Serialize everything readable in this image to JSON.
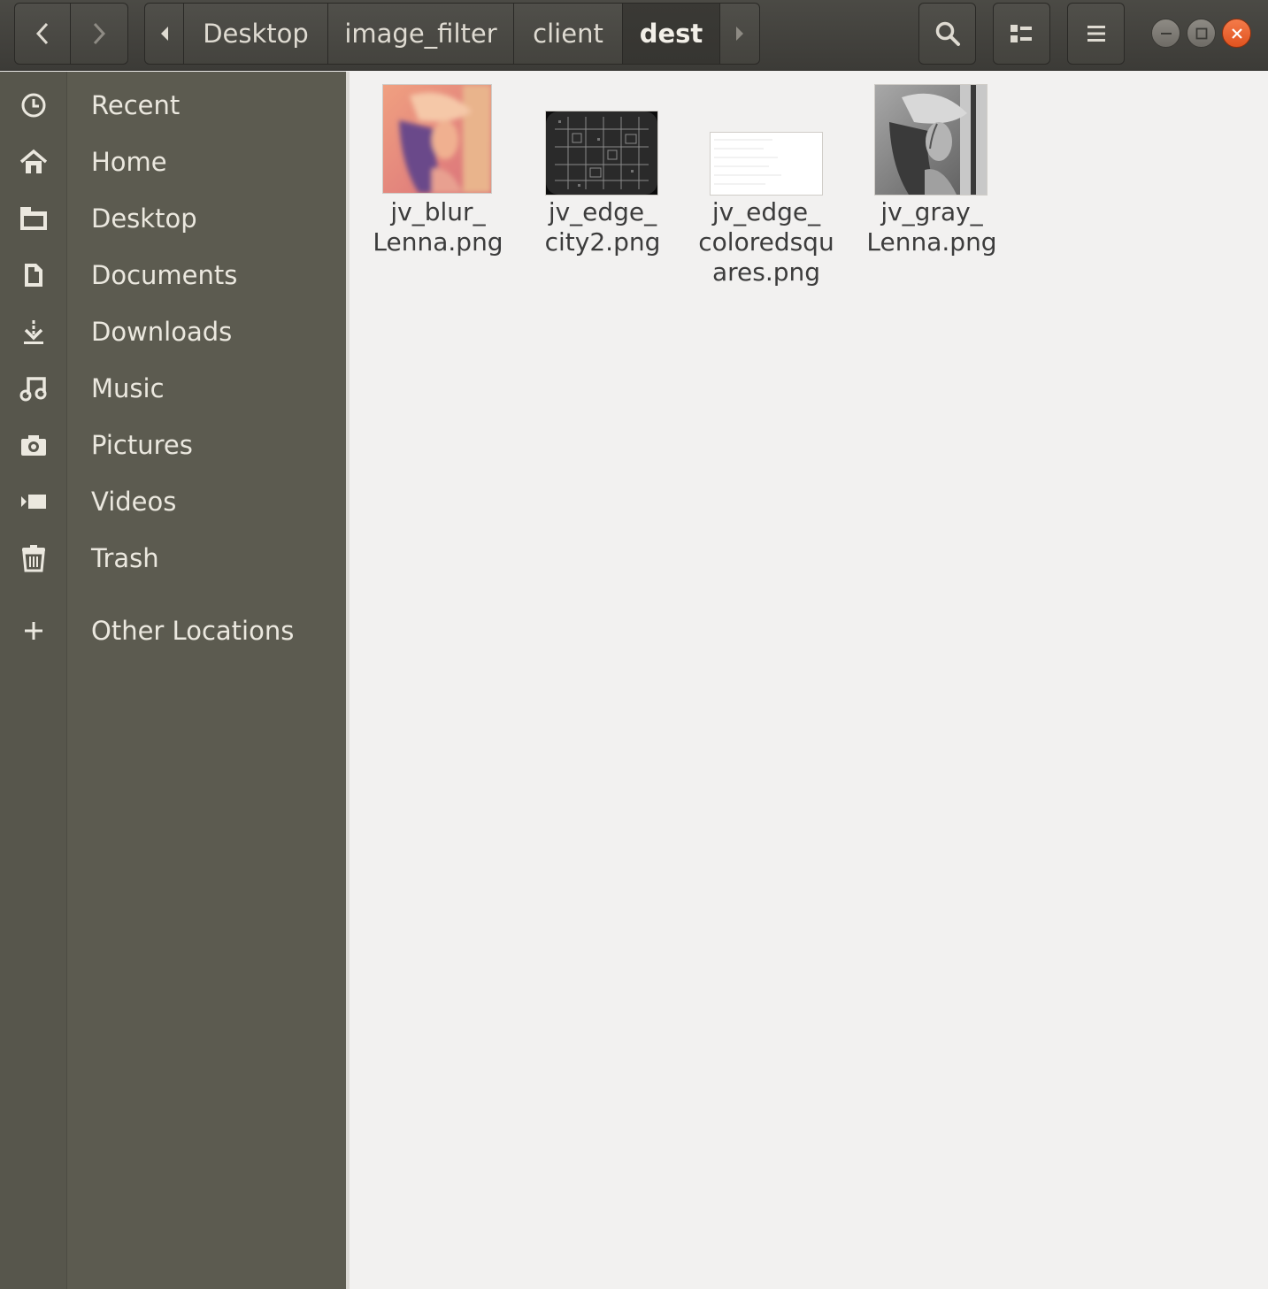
{
  "header": {
    "pathbar": {
      "segments": [
        "Desktop",
        "image_filter",
        "client",
        "dest"
      ],
      "active": "dest"
    }
  },
  "sidebar": {
    "items": [
      {
        "label": "Recent",
        "icon": "clock-icon"
      },
      {
        "label": "Home",
        "icon": "home-icon"
      },
      {
        "label": "Desktop",
        "icon": "folder-icon"
      },
      {
        "label": "Documents",
        "icon": "document-icon"
      },
      {
        "label": "Downloads",
        "icon": "download-icon"
      },
      {
        "label": "Music",
        "icon": "music-icon"
      },
      {
        "label": "Pictures",
        "icon": "camera-icon"
      },
      {
        "label": "Videos",
        "icon": "video-icon"
      },
      {
        "label": "Trash",
        "icon": "trash-icon"
      },
      {
        "label": "Other Locations",
        "icon": "plus-icon"
      }
    ]
  },
  "files": [
    {
      "name": "jv_blur_\nLenna.png",
      "thumbnail": "color blurred portrait"
    },
    {
      "name": "jv_edge_\ncity2.png",
      "thumbnail": "dark edge-detected city"
    },
    {
      "name": "jv_edge_\ncoloredsqu\nares.png",
      "thumbnail": "mostly white image"
    },
    {
      "name": "jv_gray_\nLenna.png",
      "thumbnail": "grayscale portrait"
    }
  ],
  "colors": {
    "headerbar": "#3c3b37",
    "sidebar": "#5c5b50",
    "close_button": "#e0531f",
    "content_bg": "#f2f1f0"
  }
}
